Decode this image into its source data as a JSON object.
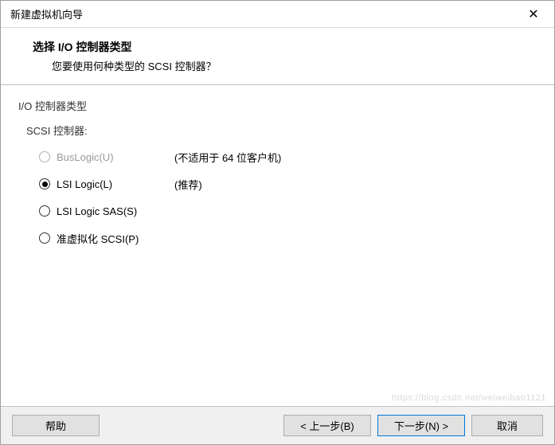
{
  "window": {
    "title": "新建虚拟机向导"
  },
  "header": {
    "title": "选择 I/O 控制器类型",
    "subtitle": "您要使用何种类型的 SCSI 控制器？"
  },
  "group": {
    "label": "I/O 控制器类型",
    "sub_label": "SCSI 控制器:"
  },
  "options": [
    {
      "label": "BusLogic(U)",
      "hint": "(不适用于 64 位客户机)",
      "selected": false,
      "disabled": true
    },
    {
      "label": "LSI Logic(L)",
      "hint": "(推荐)",
      "selected": true,
      "disabled": false
    },
    {
      "label": "LSI Logic SAS(S)",
      "hint": "",
      "selected": false,
      "disabled": false
    },
    {
      "label": "准虚拟化 SCSI(P)",
      "hint": "",
      "selected": false,
      "disabled": false
    }
  ],
  "buttons": {
    "help": "帮助",
    "back": "< 上一步(B)",
    "next": "下一步(N) >",
    "cancel": "取消"
  },
  "watermark": "https://blog.csdn.net/weiweibao1121"
}
